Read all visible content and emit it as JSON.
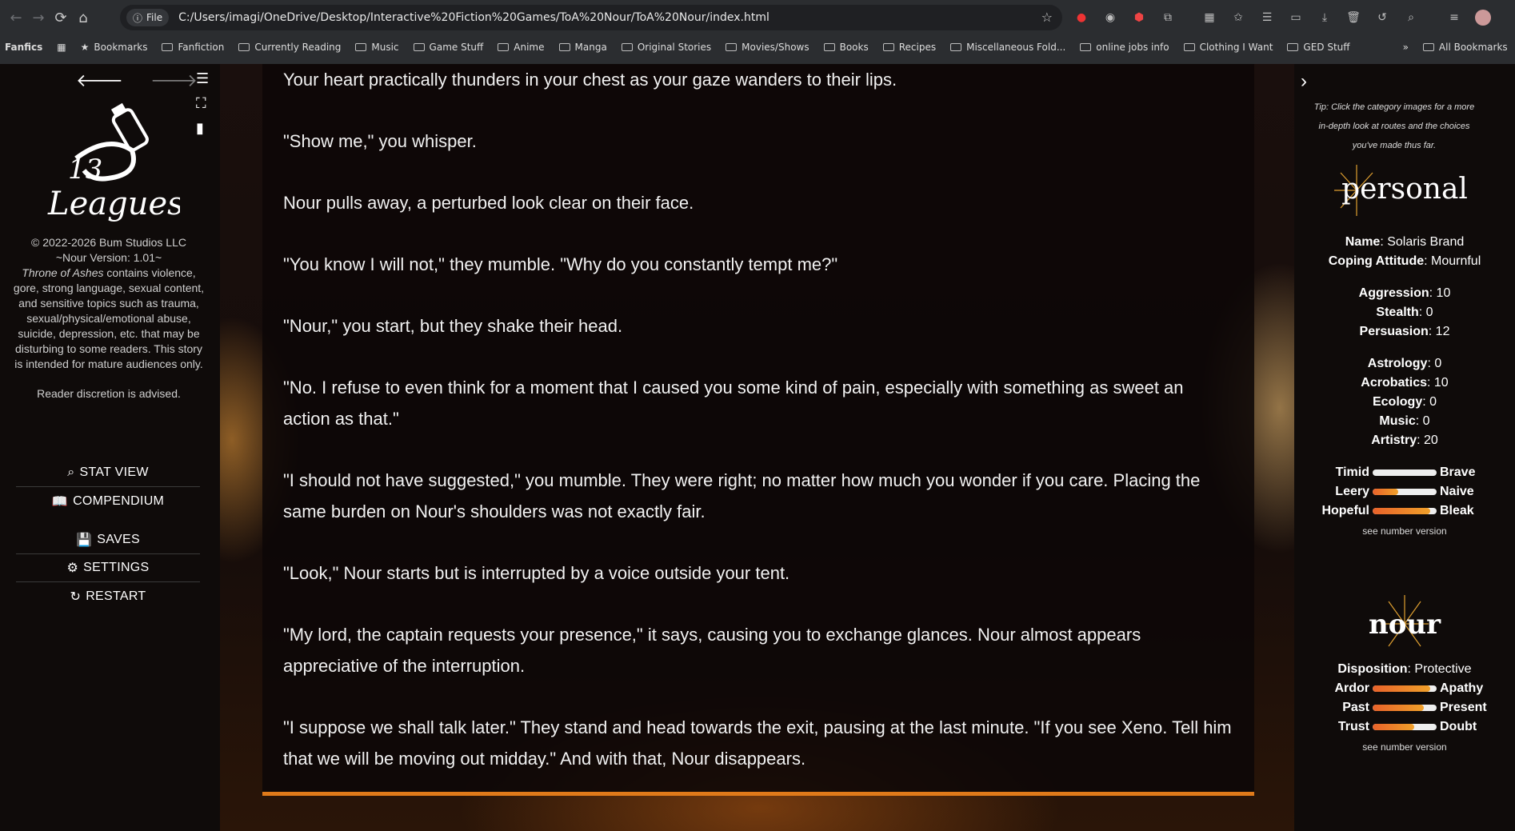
{
  "browser": {
    "url": "C:/Users/imagi/OneDrive/Desktop/Interactive%20Fiction%20Games/ToA%20Nour/ToA%20Nour/index.html",
    "file_chip": "File",
    "bookmarks": [
      "Fanfics",
      "Bookmarks",
      "Fanfiction",
      "Currently Reading",
      "Music",
      "Game Stuff",
      "Anime",
      "Manga",
      "Original Stories",
      "Movies/Shows",
      "Books",
      "Recipes",
      "Miscellaneous Fold...",
      "online jobs info",
      "Clothing I Want",
      "GED Stuff",
      "All Bookmarks"
    ]
  },
  "left": {
    "logo_top": "13",
    "logo_bottom": "Leagues",
    "copyright": "© 2022-2026 Bum Studios LLC",
    "version": "~Nour Version: 1.01~",
    "title_ital": "Throne of Ashes",
    "warning": "contains violence, gore, strong language, sexual content, and sensitive topics such as trauma, sexual/physical/emotional abuse, suicide, depression, etc. that may be disturbing to some readers. This story is intended for mature audiences only.",
    "discretion": "Reader discretion is advised.",
    "menu": {
      "stat_view": "STAT VIEW",
      "compendium": "COMPENDIUM",
      "saves": "SAVES",
      "settings": "SETTINGS",
      "restart": "RESTART"
    }
  },
  "story": [
    "Your heart practically thunders in your chest as your gaze wanders to their lips.",
    "\"Show me,\" you whisper.",
    "Nour pulls away, a perturbed look clear on their face.",
    "\"You know I will not,\" they mumble. \"Why do you constantly tempt me?\"",
    "\"Nour,\" you start, but they shake their head.",
    "\"No. I refuse to even think for a moment that I caused you some kind of pain, especially with something as sweet an action as that.\"",
    "\"I should not have suggested,\" you mumble. They were right; no matter how much you wonder if you care. Placing the same burden on Nour's shoulders was not exactly fair.",
    "\"Look,\" Nour starts but is interrupted by a voice outside your tent.",
    "\"My lord, the captain requests your presence,\" it says, causing you to exchange glances. Nour almost appears appreciative of the interruption.",
    "\"I suppose we shall talk later.\" They stand and head towards the exit, pausing at the last minute. \"If you see Xeno. Tell him that we will be moving out midday.\" And with that, Nour disappears."
  ],
  "right": {
    "tip": "Tip: Click the category images for a more in-depth look at routes and the choices you've made thus far.",
    "personal_title": "personal",
    "name_label": "Name",
    "name_value": ": Solaris Brand",
    "coping_label": "Coping Attitude",
    "coping_value": ": Mournful",
    "stats1": [
      {
        "label": "Aggression",
        "value": ": 10"
      },
      {
        "label": "Stealth",
        "value": ": 0"
      },
      {
        "label": "Persuasion",
        "value": ": 12"
      }
    ],
    "stats2": [
      {
        "label": "Astrology",
        "value": ": 0"
      },
      {
        "label": "Acrobatics",
        "value": ": 10"
      },
      {
        "label": "Ecology",
        "value": ": 0"
      },
      {
        "label": "Music",
        "value": ": 0"
      },
      {
        "label": "Artistry",
        "value": ": 20"
      }
    ],
    "personal_sliders": [
      {
        "left": "Timid",
        "right": "Brave",
        "fill": 0.0
      },
      {
        "left": "Leery",
        "right": "Naive",
        "fill": 0.4
      },
      {
        "left": "Hopeful",
        "right": "Bleak",
        "fill": 0.9
      }
    ],
    "see_number": "see number version",
    "nour_title": "nour",
    "disposition_label": "Disposition",
    "disposition_value": ": Protective",
    "nour_sliders": [
      {
        "left": "Ardor",
        "right": "Apathy",
        "fill": 0.9
      },
      {
        "left": "Past",
        "right": "Present",
        "fill": 0.8
      },
      {
        "left": "Trust",
        "right": "Doubt",
        "fill": 0.65
      }
    ],
    "see_number2": "see number version"
  }
}
